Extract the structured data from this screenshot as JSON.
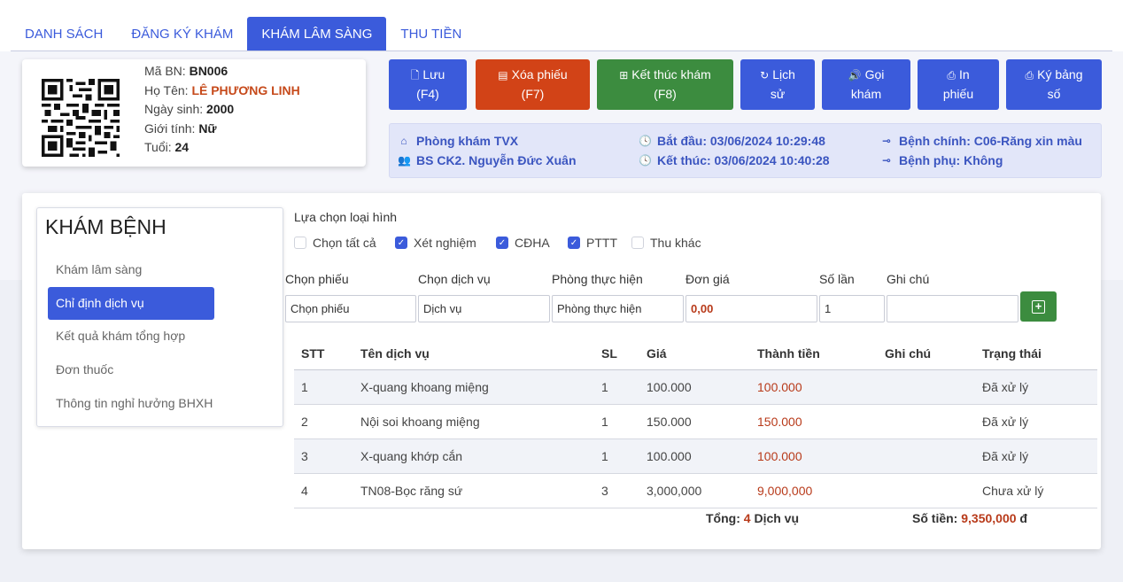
{
  "tabs": [
    {
      "label": "DANH SÁCH",
      "active": false
    },
    {
      "label": "ĐĂNG KÝ KHÁM",
      "active": false
    },
    {
      "label": "KHÁM LÂM SÀNG",
      "active": true
    },
    {
      "label": "THU TIỀN",
      "active": false
    }
  ],
  "patient": {
    "id_label": "Mã BN:",
    "id": "BN006",
    "name_label": "Họ Tên:",
    "name": "LÊ PHƯƠNG LINH",
    "dob_label": "Ngày sinh:",
    "dob": "2000",
    "gender_label": "Giới tính:",
    "gender": "Nữ",
    "age_label": "Tuổi:",
    "age": "24"
  },
  "actions": {
    "save": {
      "label": "Lưu",
      "key": "(F4)"
    },
    "delete": {
      "label": "Xóa phiếu",
      "key": "(F7)"
    },
    "finish": {
      "label": "Kết thúc khám",
      "key": "(F8)"
    },
    "history": {
      "label": "Lịch",
      "label2": "sử"
    },
    "call": {
      "label": "Gọi",
      "label2": "khám"
    },
    "print": {
      "label": "In",
      "label2": "phiếu"
    },
    "sign": {
      "label": "Ký bảng",
      "label2": "số"
    }
  },
  "info": {
    "clinic": "Phòng khám TVX",
    "doctor": "BS CK2. Nguyễn Đức Xuân",
    "start": "Bắt đầu: 03/06/2024 10:29:48",
    "end": "Kết thúc: 03/06/2024 10:40:28",
    "main_disease": "Bệnh chính: C06-Răng xin màu",
    "sub_disease": "Bệnh phụ: Không"
  },
  "sidebar": {
    "title": "KHÁM BỆNH",
    "items": [
      {
        "label": "Khám lâm sàng",
        "active": false
      },
      {
        "label": "Chỉ định dịch vụ",
        "active": true
      },
      {
        "label": "Kết quả khám tổng hợp",
        "active": false
      },
      {
        "label": "Đơn thuốc",
        "active": false
      },
      {
        "label": "Thông tin nghỉ hưởng BHXH",
        "active": false
      }
    ]
  },
  "type_section": {
    "label": "Lựa chọn loại hình",
    "options": [
      {
        "label": "Chọn tất cả",
        "checked": false
      },
      {
        "label": "Xét nghiệm",
        "checked": true
      },
      {
        "label": "CĐHA",
        "checked": true
      },
      {
        "label": "PTTT",
        "checked": true
      },
      {
        "label": "Thu khác",
        "checked": false
      }
    ]
  },
  "form": {
    "labels": {
      "ticket": "Chọn phiếu",
      "service": "Chọn dịch vụ",
      "room": "Phòng thực hiện",
      "price": "Đơn giá",
      "times": "Số lần",
      "note": "Ghi chú"
    },
    "values": {
      "ticket": "Chọn phiếu",
      "service": "Dịch vụ",
      "room": "Phòng thực hiện",
      "price": "0,00",
      "times": "1",
      "note": ""
    }
  },
  "table": {
    "headers": [
      "STT",
      "Tên dịch vụ",
      "SL",
      "Giá",
      "Thành tiền",
      "Ghi chú",
      "Trạng thái"
    ],
    "rows": [
      {
        "stt": "1",
        "name": "X-quang khoang miệng",
        "sl": "1",
        "price": "100.000",
        "total": "100.000",
        "note": "",
        "status": "Đã xử lý"
      },
      {
        "stt": "2",
        "name": "Nội soi khoang miệng",
        "sl": "1",
        "price": "150.000",
        "total": "150.000",
        "note": "",
        "status": "Đã xử lý"
      },
      {
        "stt": "3",
        "name": "X-quang khớp cắn",
        "sl": "1",
        "price": "100.000",
        "total": "100.000",
        "note": "",
        "status": "Đã xử lý"
      },
      {
        "stt": "4",
        "name": "TN08-Bọc răng sứ",
        "sl": "3",
        "price": "3,000,000",
        "total": "9,000,000",
        "note": "",
        "status": "Chưa xử lý"
      }
    ]
  },
  "summary": {
    "total_label": "Tổng:",
    "total_count": "4",
    "total_unit": "Dịch vụ",
    "amount_label": "Số tiền:",
    "amount": "9,350,000",
    "currency": "đ"
  },
  "colors": {
    "primary": "#3b5bdb",
    "danger": "#d24317",
    "success": "#3c8c3f",
    "money": "#b83a1a"
  }
}
